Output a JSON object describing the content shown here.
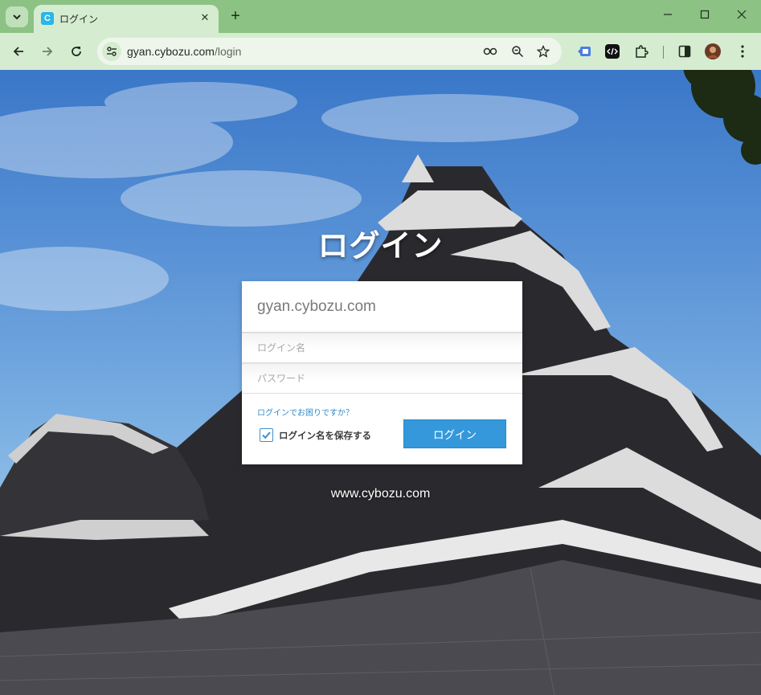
{
  "browser": {
    "tab_title": "ログイン",
    "favicon_letter": "C",
    "url_host": "gyan.cybozu.com",
    "url_path": "/login"
  },
  "login": {
    "heading": "ログイン",
    "domain": "gyan.cybozu.com",
    "username_placeholder": "ログイン名",
    "password_placeholder": "パスワード",
    "help_link": "ログインでお困りですか？",
    "remember_label": "ログイン名を保存する",
    "remember_checked": true,
    "submit_label": "ログイン"
  },
  "footer": {
    "url": "www.cybozu.com"
  },
  "colors": {
    "accent": "#3498db",
    "chrome": "#8cc283",
    "toolbar": "#d6ecd1"
  }
}
